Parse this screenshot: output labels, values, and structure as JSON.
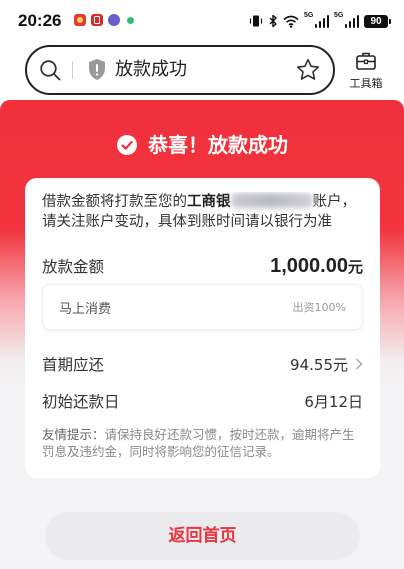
{
  "status_bar": {
    "time": "20:26",
    "notification_icons": [
      "app-icon-red",
      "app-icon-red-2",
      "app-icon-purple",
      "green-dot-icon"
    ],
    "network_1": "5G",
    "network_2": "5G",
    "battery": "90"
  },
  "search": {
    "query": "放款成功"
  },
  "toolbox": {
    "label": "工具箱"
  },
  "banner": {
    "title": "恭喜！放款成功"
  },
  "card": {
    "notice": {
      "prefix": "借款金额将打款至您的",
      "bank": "工商银",
      "suffix": "账户，",
      "line2": "请关注账户变动，具体到账时间请以银行为准"
    },
    "amount": {
      "label": "放款金额",
      "value": "1,000.00",
      "unit": "元"
    },
    "lender": {
      "name": "马上消费",
      "share": "出资100%"
    },
    "first_payment": {
      "label": "首期应还",
      "value": "94.55元"
    },
    "first_due_date": {
      "label": "初始还款日",
      "value": "6月12日"
    },
    "tip": {
      "label": "友情提示：",
      "text": "请保持良好还款习惯，按时还款，逾期将产生罚息及违约金，同时将影响您的征信记录。"
    }
  },
  "actions": {
    "back_home": "返回首页"
  },
  "colors": {
    "brand_red": "#f0303c",
    "button_text": "#e8353f",
    "page_bg": "#f4f4f6"
  }
}
